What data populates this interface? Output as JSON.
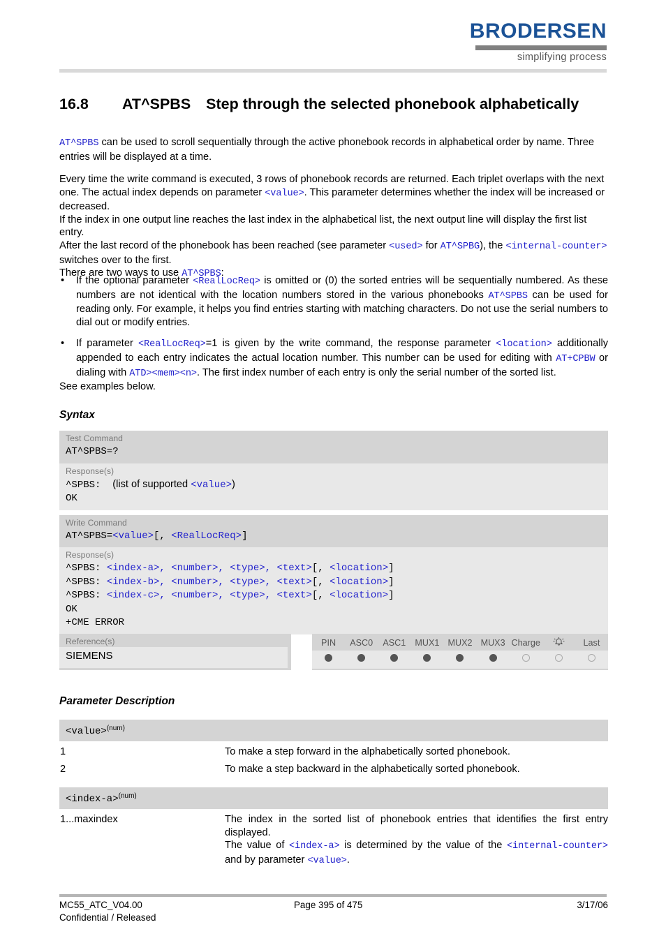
{
  "header": {
    "brand_name": "BRODERSEN",
    "brand_tagline": "simplifying process"
  },
  "title": {
    "number": "16.8",
    "command": "AT^SPBS",
    "text": "Step through the selected phonebook alphabetically"
  },
  "intro": {
    "p1_code": "AT^SPBS",
    "p1_text": " can be used to scroll sequentially through the active phonebook records in alphabetical order by name. Three entries will be displayed at a time.",
    "p2_a": "Every time the write command is executed, 3 rows of phonebook records are returned. Each triplet overlaps with the next one. The actual index depends on parameter ",
    "p2_code1": "<value>",
    "p2_b": ". This parameter determines whether the index will be increased or decreased.",
    "p3": "If the index in one output line reaches the last index in the alphabetical list, the next output line will display the first list entry.",
    "p4_a": "After the last record of the phonebook has been reached (see parameter ",
    "p4_code1": "<used>",
    "p4_b": " for ",
    "p4_code2": "AT^SPBG",
    "p4_c": "), the ",
    "p4_code3": "<internal-counter>",
    "p4_d": " switches over to the first.",
    "p5_a": "There are two ways to use ",
    "p5_code": "AT^SPBS",
    "p5_b": ":"
  },
  "bullets": [
    {
      "a": "If the optional parameter ",
      "code1": "<RealLocReq>",
      "b": " is omitted or (0) the sorted entries will be sequentially numbered. As these numbers are not identical with the location numbers stored in the various phonebooks ",
      "code2": "AT^SPBS",
      "c": " can be used for reading only. For example, it helps you find entries starting with matching characters. Do not use the serial numbers to dial out or modify entries."
    },
    {
      "a": "If parameter ",
      "code1": "<RealLocReq>",
      "b": "=1 is given by the write command, the response parameter ",
      "code2": "<location>",
      "c": " additionally appended to each entry indicates the actual location number. This number can be used for editing with ",
      "code3": "AT+CPBW",
      "d": " or dialing with ",
      "code4": "ATD><mem><n>",
      "e": ". The first index number of each entry is only the serial number of the sorted list."
    }
  ],
  "see_examples": "See examples below.",
  "sections": {
    "syntax_heading": "Syntax",
    "parameter_heading": "Parameter Description"
  },
  "syntax": {
    "test_command_label": "Test Command",
    "test_command_code": "AT^SPBS=?",
    "test_response_label": "Response(s)",
    "test_response_line1_pre": "^SPBS:",
    "test_response_line1_mid": "(list of supported ",
    "test_response_line1_var": "<value>",
    "test_response_line1_post": ")",
    "test_response_line2": "OK",
    "write_command_label": "Write Command",
    "write_command_pre": "AT^SPBS=",
    "write_command_var1": "<value>",
    "write_command_mid": "[, ",
    "write_command_var2": "<RealLocReq>",
    "write_command_post": "]",
    "write_response_label": "Response(s)",
    "write_response_lines": [
      {
        "prefix": "^SPBS: ",
        "vars": "<index-a>, <number>, <type>, <text>",
        "open": "[, ",
        "loc": "<location>",
        "close": "]"
      },
      {
        "prefix": "^SPBS: ",
        "vars": "<index-b>, <number>, <type>, <text>",
        "open": "[, ",
        "loc": "<location>",
        "close": "]"
      },
      {
        "prefix": "^SPBS: ",
        "vars": "<index-c>, <number>, <type>, <text>",
        "open": "[, ",
        "loc": "<location>",
        "close": "]"
      }
    ],
    "write_response_ok": "OK",
    "write_response_err": "+CME ERROR"
  },
  "reference": {
    "label": "Reference(s)",
    "value": "SIEMENS",
    "capabilities": [
      {
        "name": "PIN",
        "state": "on"
      },
      {
        "name": "ASC0",
        "state": "on"
      },
      {
        "name": "ASC1",
        "state": "on"
      },
      {
        "name": "MUX1",
        "state": "on"
      },
      {
        "name": "MUX2",
        "state": "on"
      },
      {
        "name": "MUX3",
        "state": "on"
      },
      {
        "name": "Charge",
        "state": "off"
      },
      {
        "name": "alarm-bell-icon",
        "state": "off"
      },
      {
        "name": "Last",
        "state": "off"
      }
    ]
  },
  "parameters": [
    {
      "name": "<value>",
      "type": "(num)",
      "rows": [
        {
          "key": "1",
          "desc": "To make a step forward in the alphabetically sorted phonebook."
        },
        {
          "key": "2",
          "desc": "To make a step backward in the alphabetically sorted phonebook."
        }
      ]
    },
    {
      "name": "<index-a>",
      "type": "(num)",
      "rows": [
        {
          "key": "1...maxindex",
          "desc_a": "The index in the sorted list of phonebook entries that identifies the first entry displayed.",
          "desc_b": "The value of ",
          "code1": "<index-a>",
          "desc_c": " is determined by the value of the ",
          "code2": "<internal-counter>",
          "desc_d": " and by parameter ",
          "code3": "<value>",
          "desc_e": "."
        }
      ]
    }
  ],
  "footer": {
    "doc_id": "MC55_ATC_V04.00",
    "classification": "Confidential / Released",
    "page": "Page 395 of 475",
    "date": "3/17/06"
  },
  "colors": {
    "brand_blue": "#1b5296",
    "code_blue": "#2222cc",
    "block_dark": "#d4d4d4",
    "block_light": "#e8e8e8"
  }
}
